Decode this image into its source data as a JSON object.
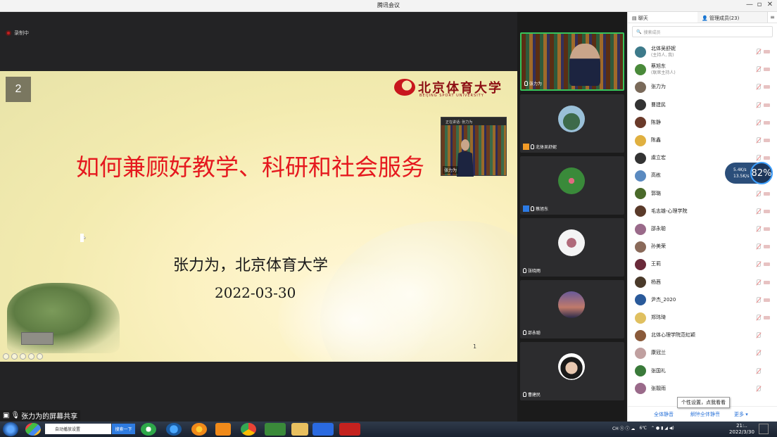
{
  "window": {
    "title": "腾讯会议",
    "min": "—",
    "max": "▫",
    "close": "✕"
  },
  "recording": {
    "label": "录制中"
  },
  "slide": {
    "page_badge": "2",
    "logo_cn": "北京体育大学",
    "logo_en": "BEIJING SPORT UNIVERSITY",
    "title": "如何兼顾好教学、科研和社会服务",
    "author": "张力为，北京体育大学",
    "date": "2022-03-30",
    "page_num": "1"
  },
  "pip": {
    "caption": "正在讲话: 张力为",
    "name": "张力为"
  },
  "share_bar": {
    "label": "张力为的屏幕共享"
  },
  "video_tiles": [
    {
      "name": "张力为"
    },
    {
      "name": "北体吴舒妮"
    },
    {
      "name": "蔡旭东"
    },
    {
      "name": "张晓雨"
    },
    {
      "name": "邵永聪"
    },
    {
      "name": "曹建民"
    }
  ],
  "panel": {
    "tab_chat": "聊天",
    "tab_members": "管理成员(23)",
    "search_placeholder": "搜索成员",
    "participants": [
      {
        "name": "北体吴舒妮",
        "sub": "(主持人, 我)",
        "color": "#3d7a8a"
      },
      {
        "name": "蔡旭东",
        "sub": "(联席主持人)",
        "color": "#4a8a3a"
      },
      {
        "name": "张力为",
        "sub": "",
        "color": "#7a6a5a"
      },
      {
        "name": "曹建民",
        "sub": "",
        "color": "#333333"
      },
      {
        "name": "陈静",
        "sub": "",
        "color": "#6a3a2a"
      },
      {
        "name": "陈鑫",
        "sub": "",
        "color": "#e0b040"
      },
      {
        "name": "虞立宏",
        "sub": "",
        "color": "#333333"
      },
      {
        "name": "高栋",
        "sub": "",
        "color": "#5a8ac0"
      },
      {
        "name": "郭璐",
        "sub": "",
        "color": "#4a6a2a"
      },
      {
        "name": "毛志雄-心理学院",
        "sub": "",
        "color": "#5a3a2a"
      },
      {
        "name": "邵永聪",
        "sub": "",
        "color": "#9a6a8a"
      },
      {
        "name": "孙美荣",
        "sub": "",
        "color": "#8a6a5a"
      },
      {
        "name": "王莉",
        "sub": "",
        "color": "#6a2a3a"
      },
      {
        "name": "杨茜",
        "sub": "",
        "color": "#4a3a2a"
      },
      {
        "name": "尹杰_2020",
        "sub": "",
        "color": "#2a5a9a"
      },
      {
        "name": "郑玮琦",
        "sub": "",
        "color": "#e0c060"
      },
      {
        "name": "北体心理学院范虹颖",
        "sub": "",
        "color": "#8a5a3a"
      },
      {
        "name": "康冠兰",
        "sub": "",
        "color": "#c0a0a0"
      },
      {
        "name": "张国礼",
        "sub": "",
        "color": "#3a7a3a"
      },
      {
        "name": "张靓雨",
        "sub": "",
        "color": "#9a6a8a"
      }
    ],
    "footer_mute_all": "全体静音",
    "footer_unmute_all": "解除全体静音",
    "footer_more": "更多 ▾"
  },
  "net": {
    "up": "5.4K/s",
    "down": "13.5K/s",
    "cpu": "82%"
  },
  "tooltip": "个性设置，点我看看",
  "speaking": "正在讲话: 张力为;",
  "taskbar": {
    "search_value": "自动播放设置",
    "search_button": "搜索一下",
    "tray_temp": "6℃",
    "time": "21:..",
    "date": "2022/3/30"
  }
}
